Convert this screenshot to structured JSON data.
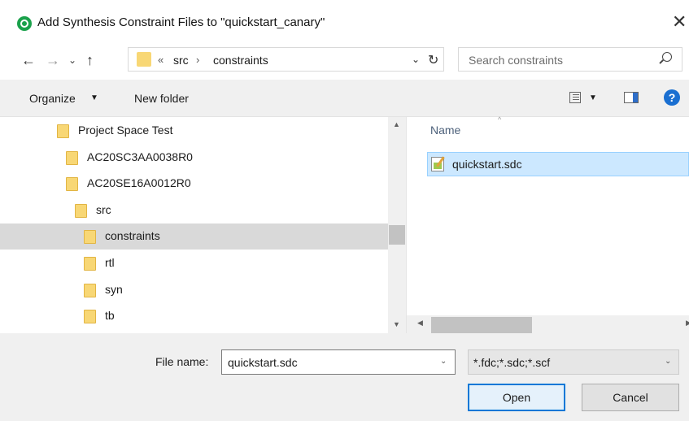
{
  "window": {
    "title": "Add Synthesis Constraint Files to \"quickstart_canary\"",
    "close_glyph": "✕"
  },
  "nav": {
    "back_glyph": "←",
    "forward_glyph": "→",
    "recent_glyph": "⌄",
    "up_glyph": "↑"
  },
  "address": {
    "overflow": "«",
    "segments": [
      "src",
      "constraints"
    ],
    "separator": "›",
    "dropdown_glyph": "⌄",
    "refresh_glyph": "↻"
  },
  "search": {
    "placeholder": "Search constraints"
  },
  "toolbar": {
    "organize": "Organize",
    "organize_caret": "▼",
    "new_folder": "New folder",
    "view_caret": "▼",
    "help": "?"
  },
  "tree": {
    "items": [
      {
        "label": "Project Space Test",
        "indent": 1,
        "selected": false
      },
      {
        "label": "AC20SC3AA0038R0",
        "indent": 2,
        "selected": false
      },
      {
        "label": "AC20SE16A0012R0",
        "indent": 2,
        "selected": false
      },
      {
        "label": "src",
        "indent": 3,
        "selected": false
      },
      {
        "label": "constraints",
        "indent": 4,
        "selected": true
      },
      {
        "label": "rtl",
        "indent": 4,
        "selected": false
      },
      {
        "label": "syn",
        "indent": 4,
        "selected": false
      },
      {
        "label": "tb",
        "indent": 4,
        "selected": false
      }
    ],
    "scroll_up": "▲",
    "scroll_down": "▼"
  },
  "files": {
    "sort_caret": "^",
    "column_name": "Name",
    "items": [
      "quickstart.sdc"
    ],
    "scroll_left": "◀",
    "scroll_right": "▶"
  },
  "footer": {
    "file_name_label": "File name:",
    "file_name_value": "quickstart.sdc",
    "file_name_drop": "⌄",
    "filter_value": "*.fdc;*.sdc;*.scf",
    "filter_drop": "⌄",
    "open_button": "Open",
    "cancel_button": "Cancel"
  },
  "colors": {
    "selected_tree_row": "#d9d9d9",
    "selected_file_row": "#cce8ff",
    "accent": "#0078d7",
    "folder": "#f8d775"
  }
}
